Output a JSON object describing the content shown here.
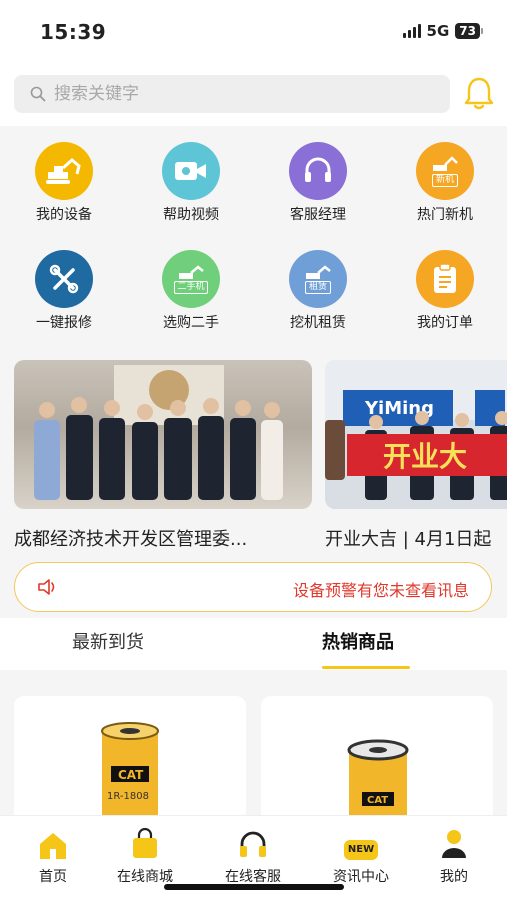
{
  "status": {
    "time": "15:39",
    "network": "5G",
    "battery": "73"
  },
  "search": {
    "placeholder": "搜索关键字"
  },
  "quick_menu": [
    {
      "label": "我的设备",
      "icon": "excavator-icon",
      "color": "#f5b800"
    },
    {
      "label": "帮助视频",
      "icon": "video-camera-icon",
      "color": "#5ec5d6"
    },
    {
      "label": "客服经理",
      "icon": "headset-icon",
      "color": "#8a6fd6"
    },
    {
      "label": "热门新机",
      "icon": "new-machine-icon",
      "color": "#f5a623",
      "badge": "新机"
    },
    {
      "label": "一键报修",
      "icon": "repair-tools-icon",
      "color": "#1f6aa0"
    },
    {
      "label": "选购二手",
      "icon": "used-machine-icon",
      "color": "#6fcf7a",
      "badge": "二手机"
    },
    {
      "label": "挖机租赁",
      "icon": "rental-machine-icon",
      "color": "#6f9fd6",
      "badge": "租赁"
    },
    {
      "label": "我的订单",
      "icon": "order-clipboard-icon",
      "color": "#f5a623"
    }
  ],
  "news": [
    {
      "title": "成都经济技术开发区管理委..."
    },
    {
      "title": "开业大吉 | 4月1日起",
      "banner_text": "开业大",
      "logo_text": "YiMing"
    }
  ],
  "notice": {
    "text": "设备预警有您未查看讯息"
  },
  "tabs": {
    "latest": "最新到货",
    "hot": "热销商品"
  },
  "products": [
    {
      "brand": "CAT",
      "part": "1R-1808"
    },
    {
      "brand": "CAT",
      "part": ""
    }
  ],
  "bottom_nav": [
    {
      "label": "首页",
      "icon": "home-icon"
    },
    {
      "label": "在线商城",
      "icon": "shopping-bag-icon"
    },
    {
      "label": "在线客服",
      "icon": "headset-icon"
    },
    {
      "label": "资讯中心",
      "icon": "news-icon",
      "badge": "NEW"
    },
    {
      "label": "我的",
      "icon": "user-icon"
    }
  ],
  "colors": {
    "accent": "#f5c518",
    "alert": "#e0382c"
  }
}
